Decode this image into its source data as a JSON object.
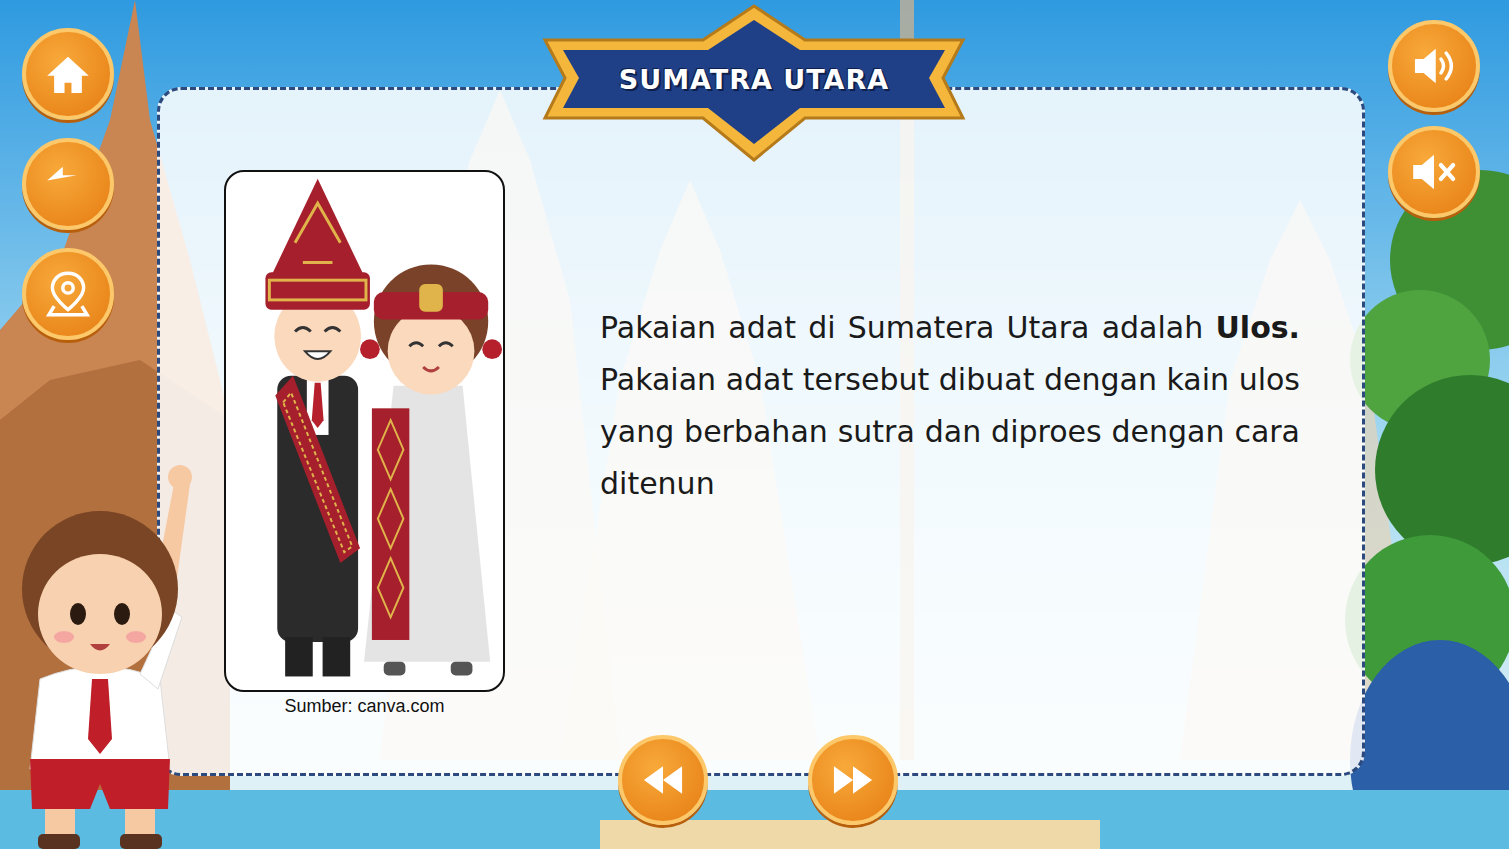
{
  "title": "SUMATRA UTARA",
  "figure": {
    "caption": "Sumber: canva.com"
  },
  "description": [
    {
      "text": "Pakaian adat di Sumatera Utara adalah ",
      "bold": false
    },
    {
      "text": "Ulos.",
      "bold": true
    },
    {
      "text": " Pakaian adat tersebut dibuat dengan kain ulos yang berbahan sutra dan diproes dengan cara ditenun",
      "bold": false
    }
  ]
}
